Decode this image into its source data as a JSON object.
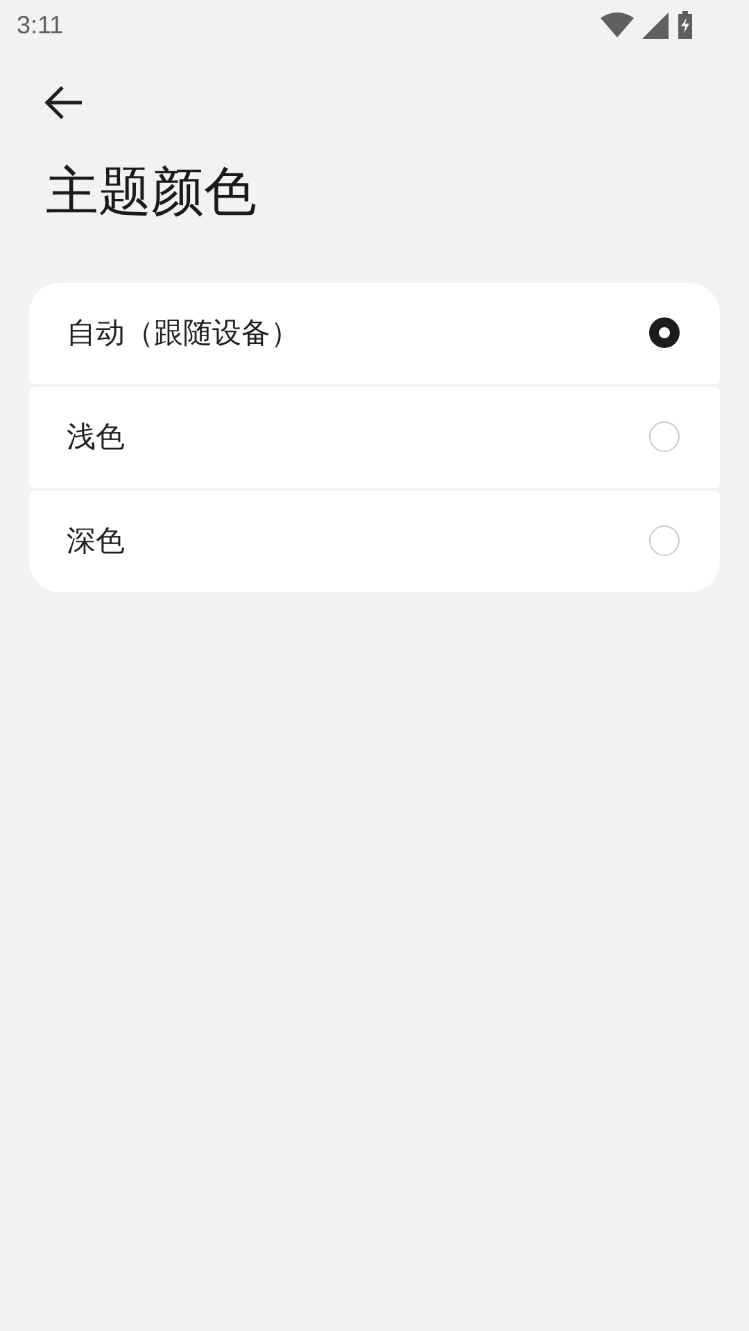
{
  "status_bar": {
    "time": "3:11"
  },
  "title": "主题颜色",
  "options": [
    {
      "label": "自动（跟随设备）",
      "selected": true
    },
    {
      "label": "浅色",
      "selected": false
    },
    {
      "label": "深色",
      "selected": false
    }
  ]
}
